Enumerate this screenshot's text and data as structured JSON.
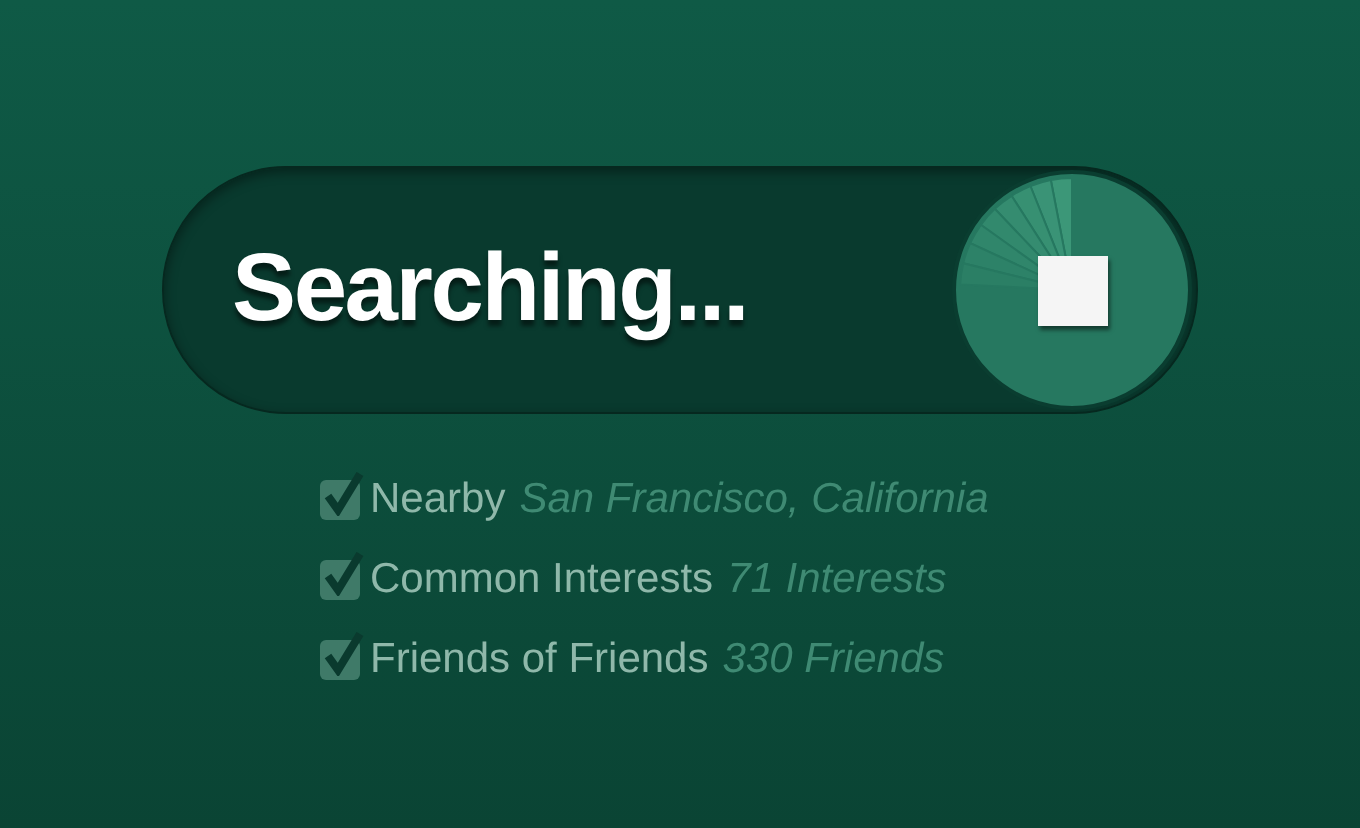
{
  "status": {
    "label": "Searching..."
  },
  "criteria": [
    {
      "label": "Nearby",
      "detail": "San Francisco, California",
      "checked": true
    },
    {
      "label": "Common Interests",
      "detail": "71 Interests",
      "checked": true
    },
    {
      "label": "Friends of Friends",
      "detail": "330 Friends",
      "checked": true
    }
  ]
}
